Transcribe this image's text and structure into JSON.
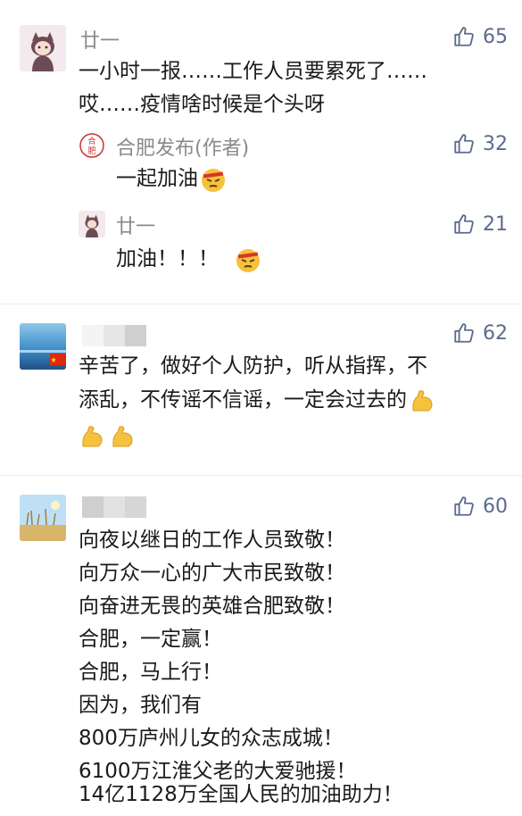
{
  "comments": [
    {
      "author": "廿一",
      "likes": "65",
      "lines": [
        "一小时一报……工作人员要累死了……",
        "哎……疫情啥时候是个头呀"
      ],
      "replies": [
        {
          "author": "合肥发布(作者)",
          "likes": "32",
          "text": "一起加油"
        },
        {
          "author": "廿一",
          "likes": "21",
          "text": "加油！！！"
        }
      ]
    },
    {
      "author": "",
      "likes": "62",
      "lines": [
        "辛苦了，做好个人防护，听从指挥，不",
        "添乱，不传谣不信谣，一定会过去的"
      ]
    },
    {
      "author": "",
      "likes": "60",
      "lines": [
        "向夜以继日的工作人员致敬！",
        "向万众一心的广大市民致敬！",
        "向奋进无畏的英雄合肥致敬！",
        "合肥，一定赢！",
        "合肥，马上行！",
        "因为，我们有",
        "800万庐州儿女的众志成城！",
        "6100万江淮父老的大爱驰援！",
        "14亿1128万全国人民的加油助力！"
      ]
    }
  ],
  "colors": {
    "like": "#5b6b8c",
    "name": "#8a8a8a",
    "text": "#1a1a1a"
  }
}
